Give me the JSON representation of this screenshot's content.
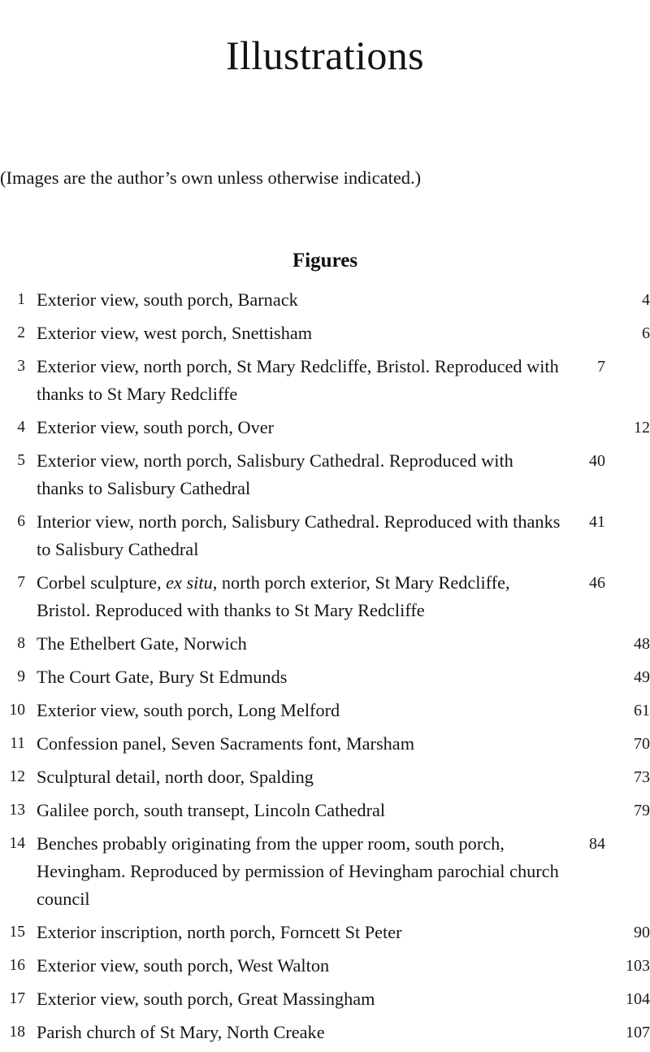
{
  "page": {
    "title": "Illustrations",
    "credit_note": "(Images are the author’s own unless otherwise indicated.)",
    "section_heading": "Figures"
  },
  "figures": [
    {
      "num": "1",
      "text": "Exterior view, south porch, Barnack",
      "page": "4"
    },
    {
      "num": "2",
      "text": "Exterior view, west porch, Snettisham",
      "page": "6"
    },
    {
      "num": "3",
      "text": "Exterior view, north porch, St Mary Redcliffe, Bristol. Reproduced with thanks to St Mary Redcliffe",
      "page": "7"
    },
    {
      "num": "4",
      "text": "Exterior view, south porch, Over",
      "page": "12"
    },
    {
      "num": "5",
      "text": "Exterior view, north porch, Salisbury Cathedral. Reproduced with thanks to Salisbury Cathedral",
      "page": "40"
    },
    {
      "num": "6",
      "text": "Interior view, north porch, Salisbury Cathedral. Reproduced with thanks to Salisbury Cathedral",
      "page": "41"
    },
    {
      "num": "7",
      "text_pre": "Corbel sculpture, ",
      "text_italic": "ex situ",
      "text_post": ", north porch exterior, St Mary Redcliffe, Bristol. Reproduced with thanks to St Mary Redcliffe",
      "page": "46"
    },
    {
      "num": "8",
      "text": "The Ethelbert Gate, Norwich",
      "page": "48"
    },
    {
      "num": "9",
      "text": "The Court Gate, Bury St Edmunds",
      "page": "49"
    },
    {
      "num": "10",
      "text": "Exterior view, south porch, Long Melford",
      "page": "61"
    },
    {
      "num": "11",
      "text": "Confession panel, Seven Sacraments font, Marsham",
      "page": "70"
    },
    {
      "num": "12",
      "text": "Sculptural detail, north door, Spalding",
      "page": "73"
    },
    {
      "num": "13",
      "text": "Galilee porch, south transept, Lincoln Cathedral",
      "page": "79"
    },
    {
      "num": "14",
      "text": "Benches probably originating from the upper room, south porch, Hevingham. Reproduced by permission of Hevingham parochial church council",
      "page": "84"
    },
    {
      "num": "15",
      "text": "Exterior inscription, north porch, Forncett St Peter",
      "page": "90"
    },
    {
      "num": "16",
      "text": "Exterior view, south porch, West Walton",
      "page": "103"
    },
    {
      "num": "17",
      "text": "Exterior view, south porch, Great Massingham",
      "page": "104"
    },
    {
      "num": "18",
      "text": "Parish church of St Mary, North Creake",
      "page": "107"
    }
  ]
}
